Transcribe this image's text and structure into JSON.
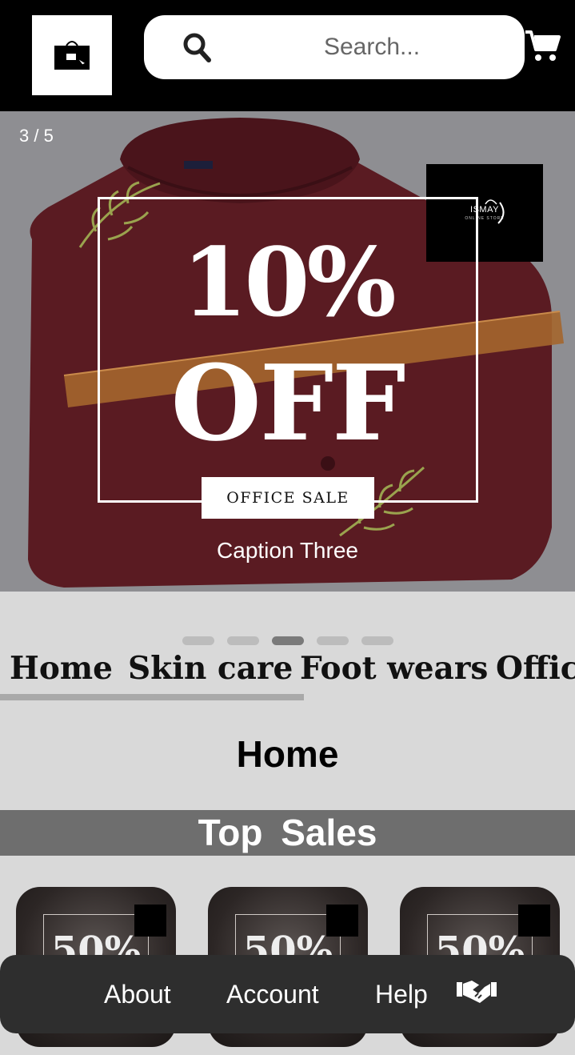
{
  "header": {
    "search_placeholder": "Search..."
  },
  "carousel": {
    "counter": "3 / 5",
    "promo_percent": "10%",
    "promo_off": "OFF",
    "promo_tag": "OFFICE SALE",
    "brand_name": "ISMAY",
    "brand_sub": "ONLINE STORE",
    "caption": "Caption Three",
    "slide_count": 5,
    "active_slide": 3
  },
  "categories": [
    "Home",
    "Skin care",
    "Foot wears",
    "Office"
  ],
  "section_title": "Home",
  "top_sales_title": "Top  Sales",
  "products": [
    {
      "promo": "50%"
    },
    {
      "promo": "50%"
    },
    {
      "promo": "50%"
    }
  ],
  "bottom_nav": {
    "about": "About",
    "account": "Account",
    "help": "Help"
  },
  "colors": {
    "header_bg": "#000000",
    "page_bg": "#d9d9d9",
    "shirt": "#5a1b22",
    "top_sales_bg": "#6e6e6e",
    "bottom_nav_bg": "#2e2e2e"
  }
}
